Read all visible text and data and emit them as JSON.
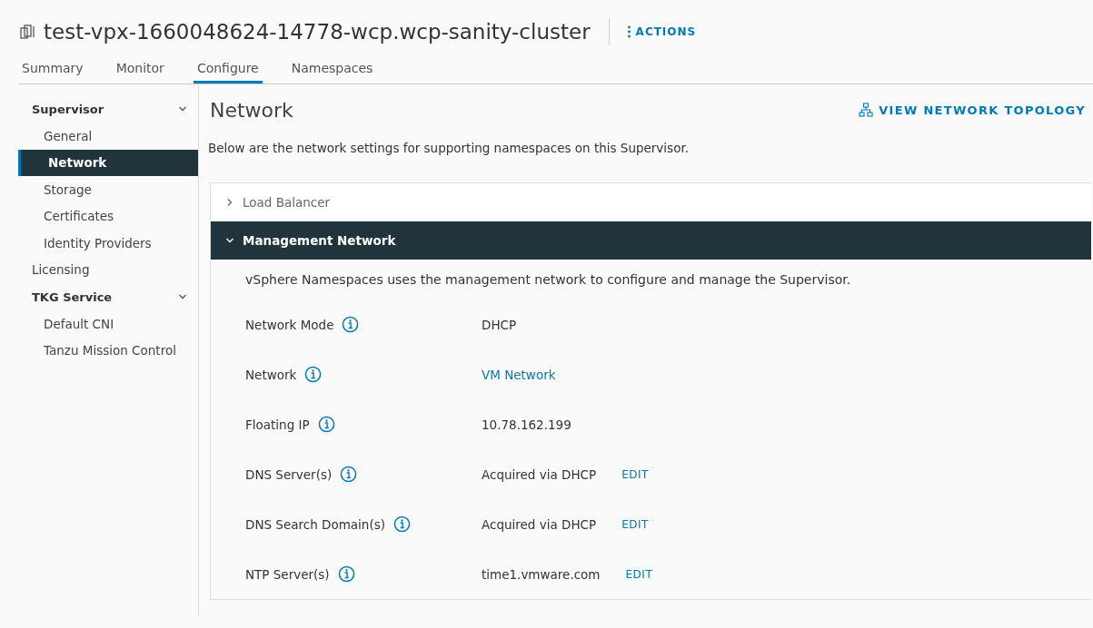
{
  "header": {
    "title": "test-vpx-1660048624-14778-wcp.wcp-sanity-cluster",
    "actions": "ACTIONS"
  },
  "tabs": [
    {
      "label": "Summary",
      "selected": false
    },
    {
      "label": "Monitor",
      "selected": false
    },
    {
      "label": "Configure",
      "selected": true
    },
    {
      "label": "Namespaces",
      "selected": false
    }
  ],
  "sidebar": {
    "items": [
      {
        "label": "Supervisor",
        "kind": "group",
        "expanded": true,
        "children": [
          {
            "label": "General",
            "selected": false
          },
          {
            "label": "Network",
            "selected": true
          },
          {
            "label": "Storage",
            "selected": false
          },
          {
            "label": "Certificates",
            "selected": false
          },
          {
            "label": "Identity Providers",
            "selected": false
          }
        ]
      },
      {
        "label": "Licensing",
        "kind": "item",
        "selected": false
      },
      {
        "label": "TKG Service",
        "kind": "group",
        "expanded": true,
        "children": [
          {
            "label": "Default CNI",
            "selected": false
          },
          {
            "label": "Tanzu Mission Control",
            "selected": false
          }
        ]
      }
    ]
  },
  "page": {
    "title": "Network",
    "topology_link": "VIEW NETWORK TOPOLOGY",
    "description": "Below are the network settings for supporting namespaces on this Supervisor."
  },
  "panels": [
    {
      "title": "Load Balancer",
      "expanded": false
    },
    {
      "title": "Management Network",
      "expanded": true,
      "description": "vSphere Namespaces uses the management network to configure and manage the Supervisor.",
      "fields": [
        {
          "label": "Network Mode",
          "value": "DHCP",
          "kind": "text"
        },
        {
          "label": "Network",
          "value": "VM Network",
          "kind": "link"
        },
        {
          "label": "Floating IP",
          "value": "10.78.162.199",
          "kind": "text"
        },
        {
          "label": "DNS Server(s)",
          "value": "Acquired via DHCP",
          "kind": "text",
          "edit": "EDIT"
        },
        {
          "label": "DNS Search Domain(s)",
          "value": "Acquired via DHCP",
          "kind": "text",
          "edit": "EDIT"
        },
        {
          "label": "NTP Server(s)",
          "value": "time1.vmware.com",
          "kind": "text",
          "edit": "EDIT"
        }
      ]
    }
  ]
}
